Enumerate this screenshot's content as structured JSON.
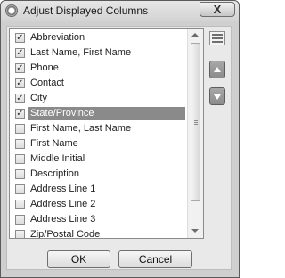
{
  "window": {
    "title": "Adjust Displayed Columns",
    "close_label": "X"
  },
  "columns": [
    {
      "label": "Abbreviation",
      "checked": true
    },
    {
      "label": "Last Name, First Name",
      "checked": true
    },
    {
      "label": "Phone",
      "checked": true
    },
    {
      "label": "Contact",
      "checked": true
    },
    {
      "label": "City",
      "checked": true
    },
    {
      "label": "State/Province",
      "checked": true,
      "selected": true
    },
    {
      "label": "First Name, Last Name",
      "checked": false
    },
    {
      "label": "First Name",
      "checked": false
    },
    {
      "label": "Middle Initial",
      "checked": false
    },
    {
      "label": "Description",
      "checked": false
    },
    {
      "label": "Address Line 1",
      "checked": false
    },
    {
      "label": "Address Line 2",
      "checked": false
    },
    {
      "label": "Address Line 3",
      "checked": false
    },
    {
      "label": "Zip/Postal Code",
      "checked": false
    }
  ],
  "buttons": {
    "ok": "OK",
    "cancel": "Cancel"
  },
  "icons": {
    "app": "app-icon",
    "toggle": "check-all-icon",
    "up": "move-up-icon",
    "down": "move-down-icon"
  }
}
